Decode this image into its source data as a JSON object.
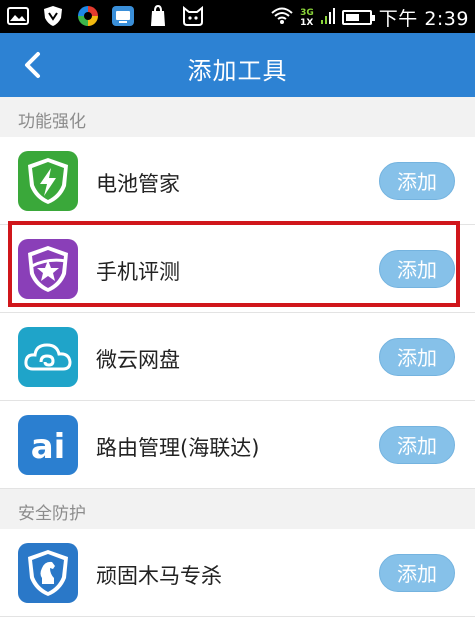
{
  "status_bar": {
    "time": "下午 2:39",
    "network_top": "3G",
    "network_bottom": "1X",
    "battery_level": 0.6
  },
  "header": {
    "title": "添加工具",
    "back_icon": "chevron-left-icon"
  },
  "sections": [
    {
      "label": "功能强化",
      "items": [
        {
          "label": "电池管家",
          "button": "添加",
          "icon": "battery-shield-icon",
          "color": "#3aa83a"
        },
        {
          "label": "手机评测",
          "button": "添加",
          "icon": "phone-test-star-icon",
          "color": "#8a3fb8",
          "highlighted": true
        },
        {
          "label": "微云网盘",
          "button": "添加",
          "icon": "cloud-icon",
          "color": "#1fa4c9"
        },
        {
          "label": "路由管理(海联达)",
          "button": "添加",
          "icon": "ai-router-icon",
          "color": "#2b7fd0"
        }
      ]
    },
    {
      "label": "安全防护",
      "items": [
        {
          "label": "顽固木马专杀",
          "button": "添加",
          "icon": "horse-shield-icon",
          "color": "#2a78c8"
        }
      ]
    }
  ],
  "colors": {
    "header": "#2d82d3",
    "button": "#86c1e9",
    "highlight_border": "#d0161b"
  }
}
